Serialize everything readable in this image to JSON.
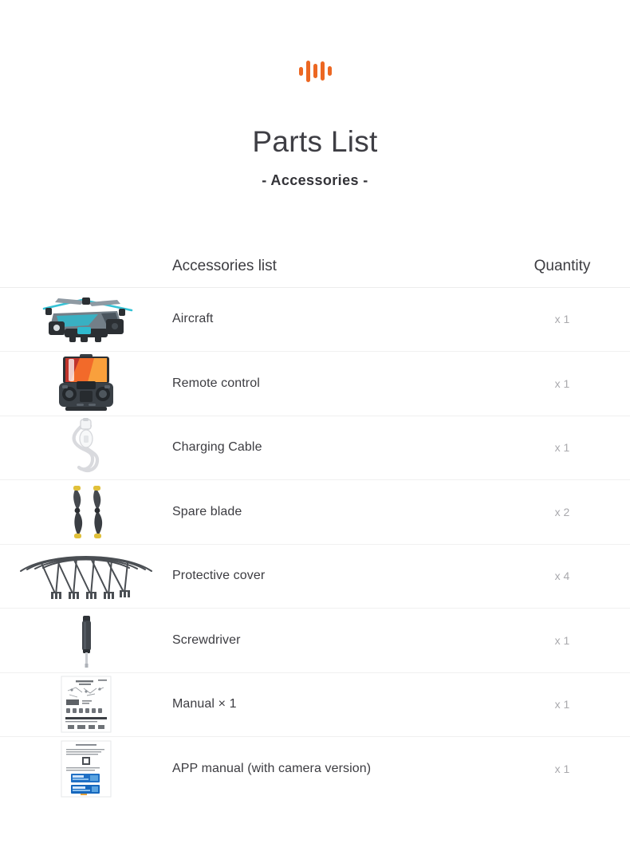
{
  "brand": {
    "logo_name": "sound-wave-logo",
    "accent_color": "#ec6722",
    "bars": 5
  },
  "header": {
    "title": "Parts List",
    "subtitle": "- Accessories -"
  },
  "table": {
    "columns": {
      "image": "",
      "name": "Accessories list",
      "quantity": "Quantity"
    },
    "rows": [
      {
        "icon": "drone-aircraft-image",
        "name": "Aircraft",
        "qty": "x 1"
      },
      {
        "icon": "remote-control-image",
        "name": "Remote control",
        "qty": "x 1"
      },
      {
        "icon": "charging-cable-image",
        "name": "Charging Cable",
        "qty": "x 1"
      },
      {
        "icon": "spare-blade-image",
        "name": "Spare blade",
        "qty": "x 2"
      },
      {
        "icon": "protective-cover-image",
        "name": "Protective cover",
        "qty": "x 4"
      },
      {
        "icon": "screwdriver-image",
        "name": "Screwdriver",
        "qty": "x 1"
      },
      {
        "icon": "manual-document-image",
        "name": "Manual × 1",
        "qty": "x 1"
      },
      {
        "icon": "app-manual-document-image",
        "name": "APP manual (with camera version)",
        "qty": "x 1"
      }
    ]
  },
  "palette": {
    "accent": "#ec6722",
    "text": "#3c3c41",
    "muted": "#a9a9ad",
    "rule": "#f0f0f0",
    "drone_body": "#6f7b84",
    "drone_accent": "#35c3d6",
    "blade_tip": "#e8c53a",
    "phone_screen": "#f26a2a"
  }
}
